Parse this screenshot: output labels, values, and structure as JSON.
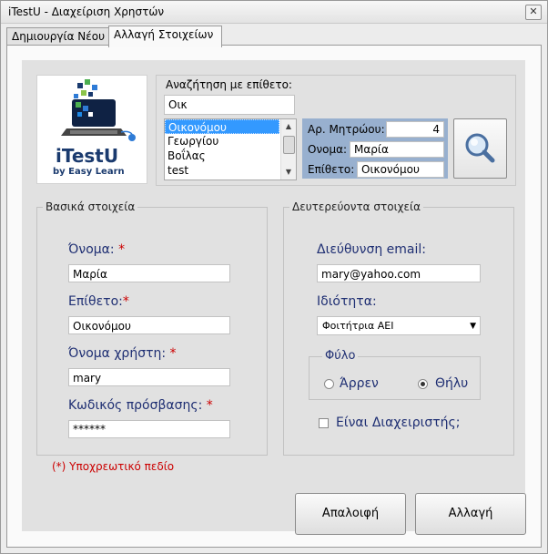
{
  "window": {
    "title": "iTestU - Διαχείριση Χρηστών",
    "close_glyph": "✕"
  },
  "tabs": [
    {
      "label": "Δημιουργία Νέου"
    },
    {
      "label": "Αλλαγή Στοιχείων"
    }
  ],
  "logo": {
    "name": "iTestU",
    "tagline": "by Easy Learn"
  },
  "search": {
    "label": "Αναζήτηση με επίθετο:",
    "value": "Οικ",
    "results": [
      "Οικονόμου",
      "Γεωργίου",
      "Βοΐλας",
      "test"
    ],
    "selected_index": 0,
    "icon": "magnifier-icon"
  },
  "selected_record": {
    "reg_label": "Αρ. Μητρώου:",
    "reg_value": "4",
    "name_label": "Ονομα:",
    "name_value": "Μαρία",
    "surname_label": "Επίθετο:",
    "surname_value": "Οικονόμου"
  },
  "basic": {
    "title": "Βασικά στοιχεία",
    "first_name_label": "Όνομα:",
    "first_name_value": "Μαρία",
    "last_name_label": "Επίθετο:",
    "last_name_value": "Οικονόμου",
    "username_label": "Όνομα χρήστη:",
    "username_value": "mary",
    "password_label": "Κωδικός πρόσβασης:",
    "password_value": "******",
    "required_mark": "*"
  },
  "secondary": {
    "title": "Δευτερεύοντα στοιχεία",
    "email_label": "Διεύθυνση email:",
    "email_value": "mary@yahoo.com",
    "role_label": "Ιδιότητα:",
    "role_value": "Φοιτήτρια ΑΕΙ",
    "gender_title": "Φύλο",
    "gender_options": [
      "Άρρεν",
      "Θήλυ"
    ],
    "gender_selected": "Θήλυ",
    "admin_label": "Είναι Διαχειριστής;",
    "admin_checked": false
  },
  "footnote": "(*) Υποχρεωτικό πεδίο",
  "buttons": {
    "clear": "Απαλοιφή",
    "change": "Αλλαγή"
  }
}
